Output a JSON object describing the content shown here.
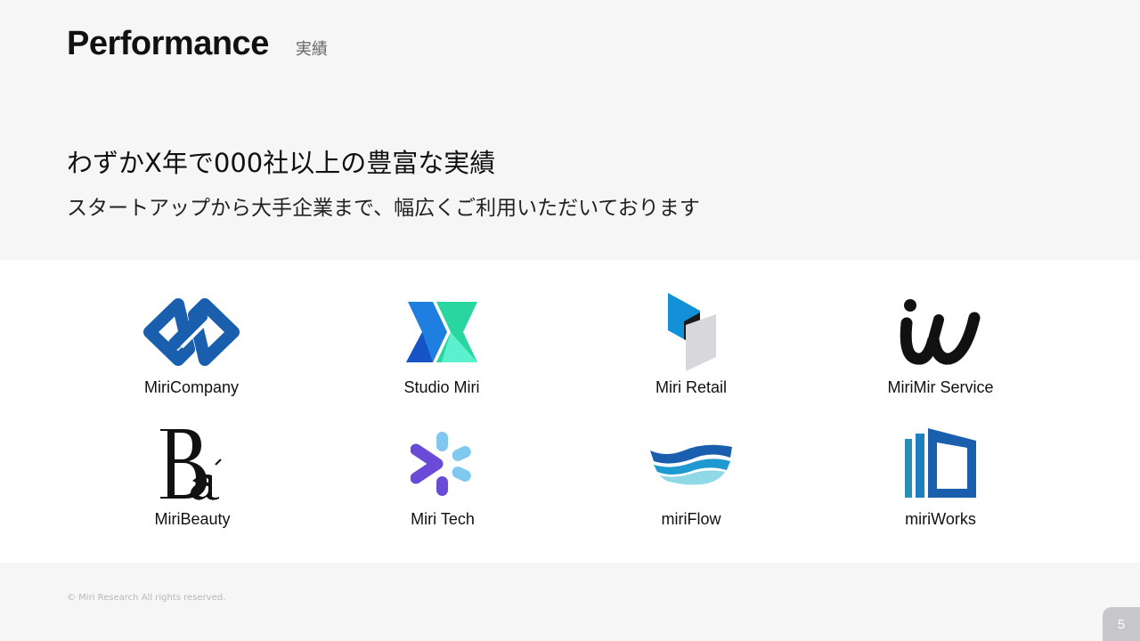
{
  "header": {
    "title": "Performance",
    "subtitle": "実績"
  },
  "main": {
    "headline": "わずかX年で000社以上の豊富な実績",
    "subline": "スタートアップから大手企業まで、幅広くご利用いただいております"
  },
  "logos": [
    {
      "name": "MiriCompany",
      "icon": "chain-link-icon"
    },
    {
      "name": "Studio Miri",
      "icon": "x-chevron-icon"
    },
    {
      "name": "Miri Retail",
      "icon": "folded-blocks-icon"
    },
    {
      "name": "MiriMir Service",
      "icon": "iw-lettermark-icon"
    },
    {
      "name": "MiriBeauty",
      "icon": "ba-monogram-icon"
    },
    {
      "name": "Miri Tech",
      "icon": "spark-arrow-icon"
    },
    {
      "name": "miriFlow",
      "icon": "waves-icon"
    },
    {
      "name": "miriWorks",
      "icon": "door-panels-icon"
    }
  ],
  "footer": {
    "copyright": "© Miri Research All rights reserved.",
    "page_number": "5"
  },
  "colors": {
    "background": "#f6f6f7",
    "band": "#ffffff",
    "accent_blue": "#1a5fae",
    "page_badge": "#c7c7c9"
  }
}
